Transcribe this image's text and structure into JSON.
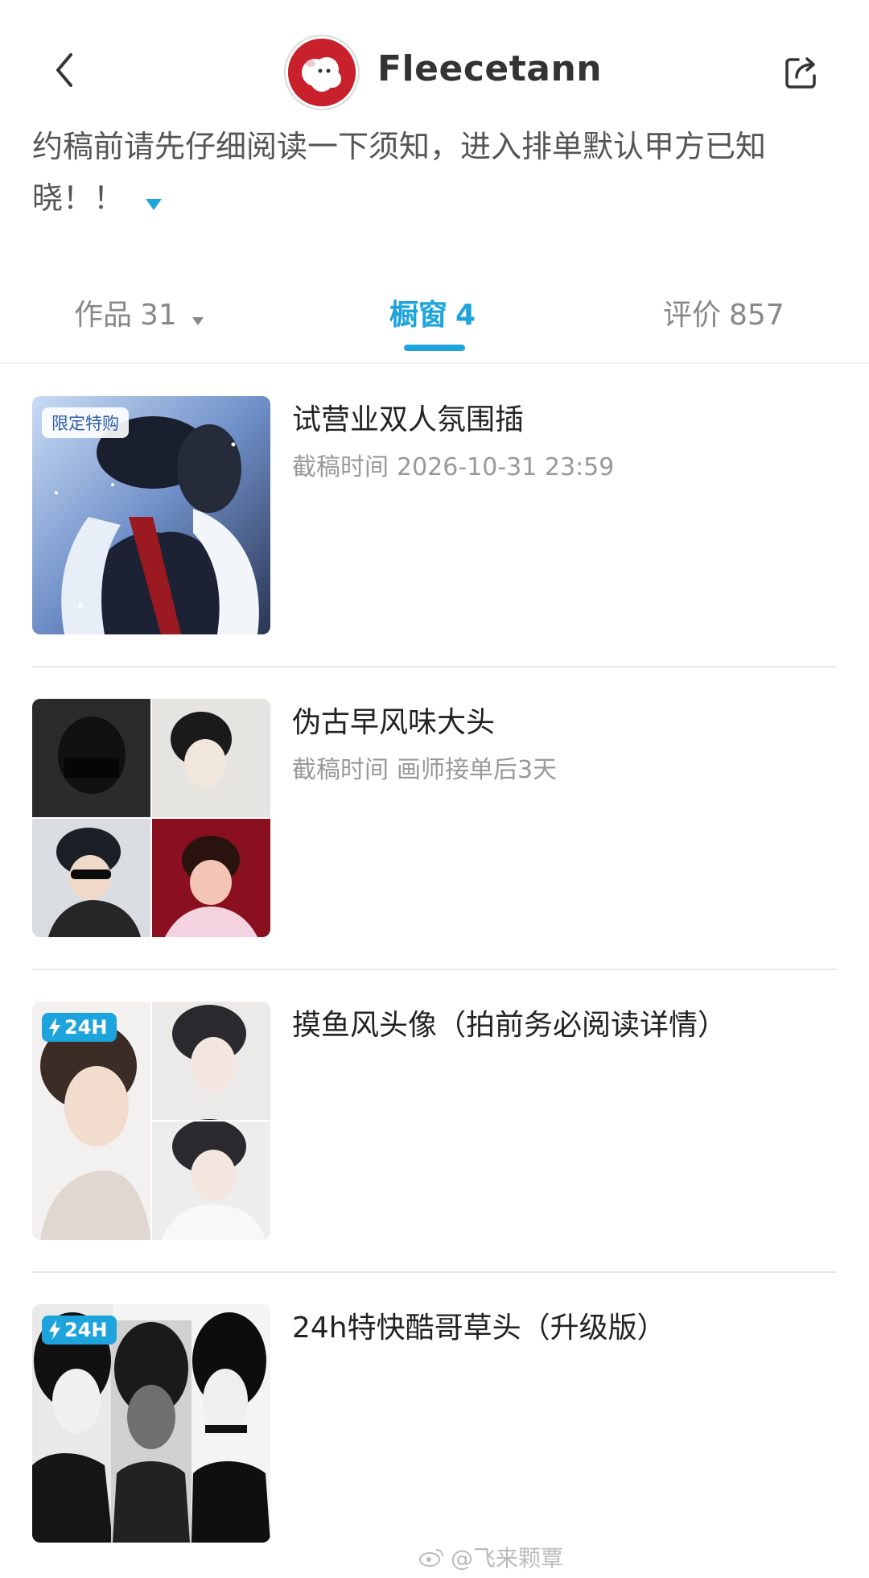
{
  "header": {
    "username": "Fleecetann",
    "notice": "约稿前请先仔细阅读一下须知，进入排单默认甲方已知晓！！",
    "icons": {
      "back": "back-chevron-icon",
      "share": "share-icon",
      "expand": "expand-triangle-icon"
    }
  },
  "tabs": [
    {
      "label": "作品",
      "count": "31",
      "active": false
    },
    {
      "label": "橱窗",
      "count": "4",
      "active": true
    },
    {
      "label": "评价",
      "count": "857",
      "active": false
    }
  ],
  "items": [
    {
      "title": "试营业双人氛围插",
      "deadline_label": "截稿时间",
      "deadline": "2026-10-31 23:59",
      "badge": "限定特购"
    },
    {
      "title": "伪古早风味大头",
      "deadline_label": "截稿时间",
      "deadline": "画师接单后3天",
      "badge": ""
    },
    {
      "title": "摸鱼风头像（拍前务必阅读详情）",
      "deadline_label": "",
      "deadline": "",
      "badge": "24H"
    },
    {
      "title": "24h特快酷哥草头（升级版）",
      "deadline_label": "",
      "deadline": "",
      "badge": "24H"
    }
  ],
  "watermark": "@飞来颗覃",
  "colors": {
    "accent": "#1ea4dc",
    "avatar_bg": "#c9212b",
    "muted_text": "#999999"
  }
}
